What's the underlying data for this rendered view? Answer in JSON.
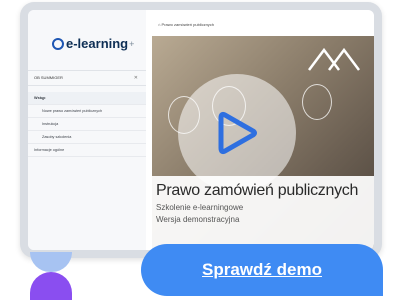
{
  "logo": {
    "text": "e-learning",
    "suffix": "+"
  },
  "sidebar": {
    "header": "OB SUMMIGER",
    "items": [
      {
        "label": "Wstęp"
      },
      {
        "label": "Nowe prawo zamówień publicznych"
      },
      {
        "label": "Instrukcja"
      },
      {
        "label": "Zasoby szkolenia"
      },
      {
        "label": "Informacje ogólne"
      }
    ]
  },
  "content": {
    "breadcrumb": "Prawo zamówień publicznych"
  },
  "slide": {
    "title": "Prawo zamówień publicznych",
    "subtitle1": "Szkolenie e-learningowe",
    "subtitle2": "Wersja demonstracyjna"
  },
  "cta": {
    "label": "Sprawdź demo"
  },
  "colors": {
    "accent": "#3f8bf3",
    "play": "#2e6fe0",
    "deco_top": "#a7c3f2",
    "deco_bottom": "#8a4ef0"
  }
}
